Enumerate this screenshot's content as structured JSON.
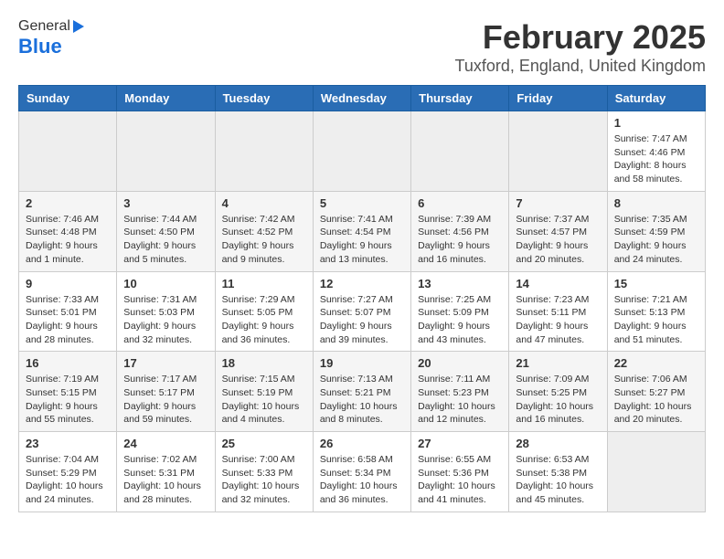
{
  "header": {
    "logo_general": "General",
    "logo_blue": "Blue",
    "title": "February 2025",
    "location": "Tuxford, England, United Kingdom"
  },
  "weekdays": [
    "Sunday",
    "Monday",
    "Tuesday",
    "Wednesday",
    "Thursday",
    "Friday",
    "Saturday"
  ],
  "weeks": [
    [
      {
        "day": "",
        "info": ""
      },
      {
        "day": "",
        "info": ""
      },
      {
        "day": "",
        "info": ""
      },
      {
        "day": "",
        "info": ""
      },
      {
        "day": "",
        "info": ""
      },
      {
        "day": "",
        "info": ""
      },
      {
        "day": "1",
        "info": "Sunrise: 7:47 AM\nSunset: 4:46 PM\nDaylight: 8 hours\nand 58 minutes."
      }
    ],
    [
      {
        "day": "2",
        "info": "Sunrise: 7:46 AM\nSunset: 4:48 PM\nDaylight: 9 hours\nand 1 minute."
      },
      {
        "day": "3",
        "info": "Sunrise: 7:44 AM\nSunset: 4:50 PM\nDaylight: 9 hours\nand 5 minutes."
      },
      {
        "day": "4",
        "info": "Sunrise: 7:42 AM\nSunset: 4:52 PM\nDaylight: 9 hours\nand 9 minutes."
      },
      {
        "day": "5",
        "info": "Sunrise: 7:41 AM\nSunset: 4:54 PM\nDaylight: 9 hours\nand 13 minutes."
      },
      {
        "day": "6",
        "info": "Sunrise: 7:39 AM\nSunset: 4:56 PM\nDaylight: 9 hours\nand 16 minutes."
      },
      {
        "day": "7",
        "info": "Sunrise: 7:37 AM\nSunset: 4:57 PM\nDaylight: 9 hours\nand 20 minutes."
      },
      {
        "day": "8",
        "info": "Sunrise: 7:35 AM\nSunset: 4:59 PM\nDaylight: 9 hours\nand 24 minutes."
      }
    ],
    [
      {
        "day": "9",
        "info": "Sunrise: 7:33 AM\nSunset: 5:01 PM\nDaylight: 9 hours\nand 28 minutes."
      },
      {
        "day": "10",
        "info": "Sunrise: 7:31 AM\nSunset: 5:03 PM\nDaylight: 9 hours\nand 32 minutes."
      },
      {
        "day": "11",
        "info": "Sunrise: 7:29 AM\nSunset: 5:05 PM\nDaylight: 9 hours\nand 36 minutes."
      },
      {
        "day": "12",
        "info": "Sunrise: 7:27 AM\nSunset: 5:07 PM\nDaylight: 9 hours\nand 39 minutes."
      },
      {
        "day": "13",
        "info": "Sunrise: 7:25 AM\nSunset: 5:09 PM\nDaylight: 9 hours\nand 43 minutes."
      },
      {
        "day": "14",
        "info": "Sunrise: 7:23 AM\nSunset: 5:11 PM\nDaylight: 9 hours\nand 47 minutes."
      },
      {
        "day": "15",
        "info": "Sunrise: 7:21 AM\nSunset: 5:13 PM\nDaylight: 9 hours\nand 51 minutes."
      }
    ],
    [
      {
        "day": "16",
        "info": "Sunrise: 7:19 AM\nSunset: 5:15 PM\nDaylight: 9 hours\nand 55 minutes."
      },
      {
        "day": "17",
        "info": "Sunrise: 7:17 AM\nSunset: 5:17 PM\nDaylight: 9 hours\nand 59 minutes."
      },
      {
        "day": "18",
        "info": "Sunrise: 7:15 AM\nSunset: 5:19 PM\nDaylight: 10 hours\nand 4 minutes."
      },
      {
        "day": "19",
        "info": "Sunrise: 7:13 AM\nSunset: 5:21 PM\nDaylight: 10 hours\nand 8 minutes."
      },
      {
        "day": "20",
        "info": "Sunrise: 7:11 AM\nSunset: 5:23 PM\nDaylight: 10 hours\nand 12 minutes."
      },
      {
        "day": "21",
        "info": "Sunrise: 7:09 AM\nSunset: 5:25 PM\nDaylight: 10 hours\nand 16 minutes."
      },
      {
        "day": "22",
        "info": "Sunrise: 7:06 AM\nSunset: 5:27 PM\nDaylight: 10 hours\nand 20 minutes."
      }
    ],
    [
      {
        "day": "23",
        "info": "Sunrise: 7:04 AM\nSunset: 5:29 PM\nDaylight: 10 hours\nand 24 minutes."
      },
      {
        "day": "24",
        "info": "Sunrise: 7:02 AM\nSunset: 5:31 PM\nDaylight: 10 hours\nand 28 minutes."
      },
      {
        "day": "25",
        "info": "Sunrise: 7:00 AM\nSunset: 5:33 PM\nDaylight: 10 hours\nand 32 minutes."
      },
      {
        "day": "26",
        "info": "Sunrise: 6:58 AM\nSunset: 5:34 PM\nDaylight: 10 hours\nand 36 minutes."
      },
      {
        "day": "27",
        "info": "Sunrise: 6:55 AM\nSunset: 5:36 PM\nDaylight: 10 hours\nand 41 minutes."
      },
      {
        "day": "28",
        "info": "Sunrise: 6:53 AM\nSunset: 5:38 PM\nDaylight: 10 hours\nand 45 minutes."
      },
      {
        "day": "",
        "info": ""
      }
    ]
  ]
}
